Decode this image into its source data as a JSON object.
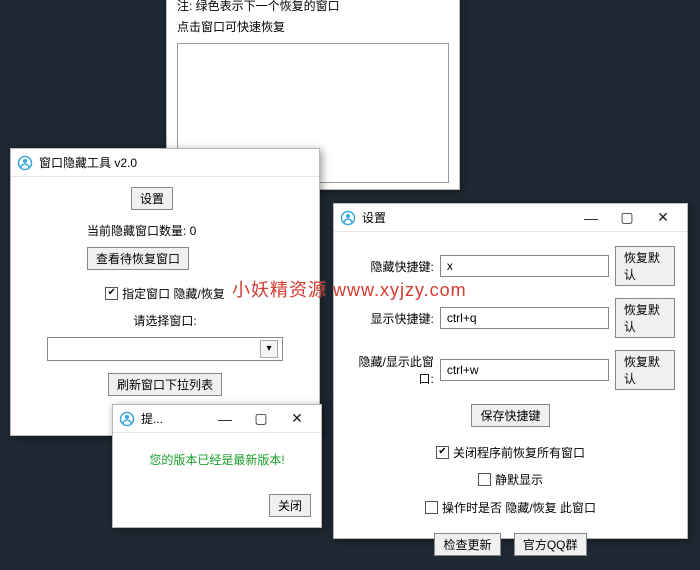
{
  "top_panel": {
    "note": "注: 绿色表示下一个恢复的窗口",
    "hint": "点击窗口可快速恢复"
  },
  "main": {
    "title": "窗口隐藏工具 v2.0",
    "settings_btn": "设置",
    "hidden_count_label": "当前隐藏窗口数量: 0",
    "view_pending_btn": "查看待恢复窗口",
    "specify_checkbox": "指定窗口 隐藏/恢复",
    "specify_checked": true,
    "select_label": "请选择窗口:",
    "refresh_btn": "刷新窗口下拉列表"
  },
  "prompt": {
    "title": "提...",
    "message": "您的版本已经是最新版本!",
    "close_btn": "关闭"
  },
  "settings": {
    "title": "设置",
    "rows": [
      {
        "label": "隐藏快捷键:",
        "value": "x",
        "reset": "恢复默认"
      },
      {
        "label": "显示快捷键:",
        "value": "ctrl+q",
        "reset": "恢复默认"
      },
      {
        "label": "隐藏/显示此窗口:",
        "value": "ctrl+w",
        "reset": "恢复默认"
      }
    ],
    "save_btn": "保存快捷键",
    "restore_all_checkbox": "关闭程序前恢复所有窗口",
    "restore_all_checked": true,
    "silent_checkbox": "静默显示",
    "silent_checked": false,
    "operate_checkbox": "操作时是否 隐藏/恢复 此窗口",
    "operate_checked": false,
    "check_update_btn": "检查更新",
    "qq_btn": "官方QQ群"
  },
  "watermark": "小妖精资源 www.xyjzy.com"
}
